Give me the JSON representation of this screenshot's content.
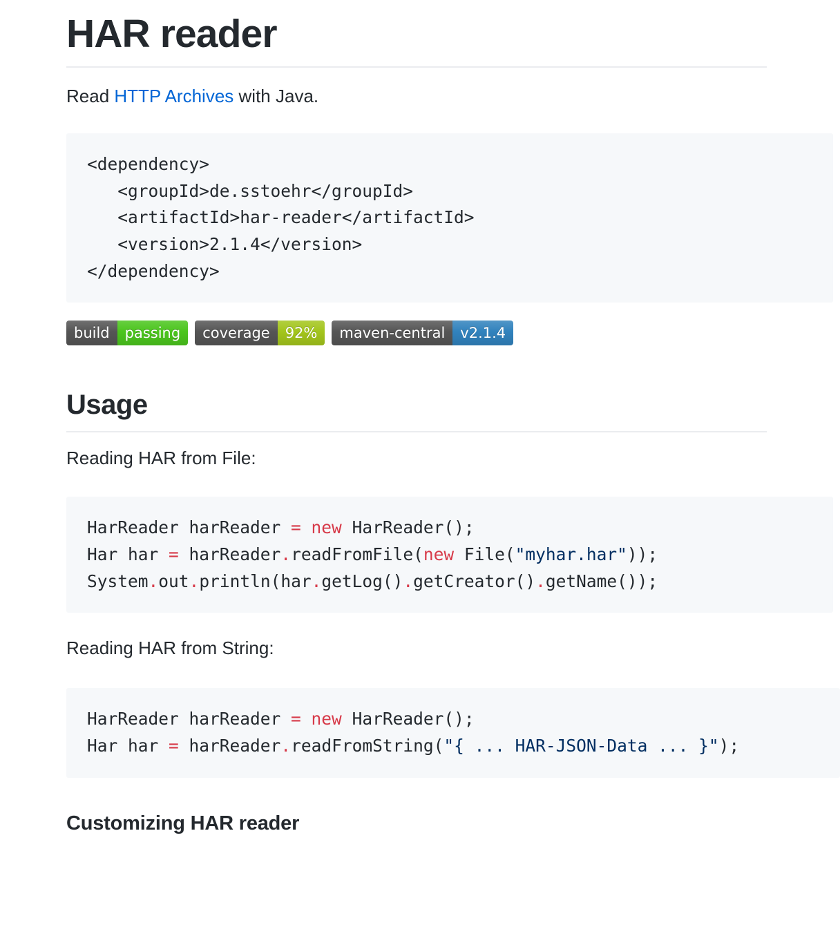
{
  "document": {
    "title": "HAR reader",
    "intro": {
      "before": "Read ",
      "link_text": "HTTP Archives",
      "after": " with Java."
    },
    "dependency_code": "<dependency>\n   <groupId>de.sstoehr</groupId>\n   <artifactId>har-reader</artifactId>\n   <version>2.1.4</version>\n</dependency>",
    "badges": [
      {
        "label": "build",
        "value": "passing",
        "label_color": "#555555",
        "value_color": "#4bc51d"
      },
      {
        "label": "coverage",
        "value": "92%",
        "label_color": "#555555",
        "value_color": "#a3c51c"
      },
      {
        "label": "maven-central",
        "value": "v2.1.4",
        "label_color": "#555555",
        "value_color": "#3182bd"
      }
    ],
    "usage": {
      "heading": "Usage",
      "file_label": "Reading HAR from File:",
      "file_code": {
        "line1": {
          "a": "HarReader harReader ",
          "op1": "=",
          "b": " ",
          "kw": "new",
          "c": " HarReader();"
        },
        "line2": {
          "a": "Har har ",
          "op1": "=",
          "b": " harReader",
          "op2": ".",
          "c": "readFromFile(",
          "kw": "new",
          "d": " File(",
          "str": "\"myhar.har\"",
          "e": "));"
        },
        "line3": {
          "a": "System",
          "op1": ".",
          "b": "out",
          "op2": ".",
          "c": "println(har",
          "op3": ".",
          "d": "getLog()",
          "op4": ".",
          "e": "getCreator()",
          "op5": ".",
          "f": "getName());"
        }
      },
      "string_label": "Reading HAR from String:",
      "string_code": {
        "line1": {
          "a": "HarReader harReader ",
          "op1": "=",
          "b": " ",
          "kw": "new",
          "c": " HarReader();"
        },
        "line2": {
          "a": "Har har ",
          "op1": "=",
          "b": " harReader",
          "op2": ".",
          "c": "readFromString(",
          "str": "\"{ ... HAR-JSON-Data ... }\"",
          "d": ");"
        }
      }
    },
    "customizing_heading": "Customizing HAR reader",
    "colors": {
      "link": "#0366d6",
      "code_bg": "#f6f8fa",
      "rule": "#eaecef",
      "text": "#24292e",
      "code_string": "#032f62",
      "code_keyword": "#d73a49"
    }
  }
}
